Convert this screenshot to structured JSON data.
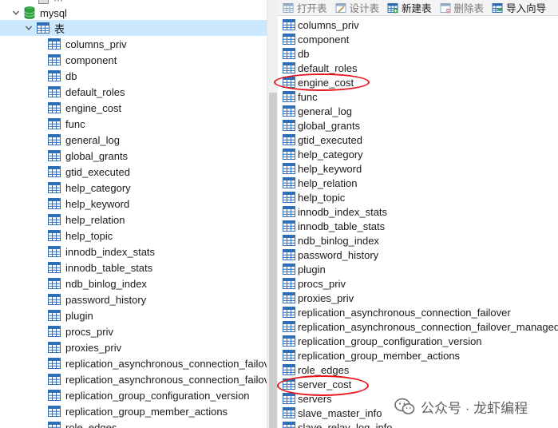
{
  "tree": {
    "top_stub_label": "···",
    "database": "mysql",
    "tables_folder": "表",
    "tables": [
      "columns_priv",
      "component",
      "db",
      "default_roles",
      "engine_cost",
      "func",
      "general_log",
      "global_grants",
      "gtid_executed",
      "help_category",
      "help_keyword",
      "help_relation",
      "help_topic",
      "innodb_index_stats",
      "innodb_table_stats",
      "ndb_binlog_index",
      "password_history",
      "plugin",
      "procs_priv",
      "proxies_priv",
      "replication_asynchronous_connection_failove",
      "replication_asynchronous_connection_failove",
      "replication_group_configuration_version",
      "replication_group_member_actions",
      "role_edges"
    ]
  },
  "toolbar": {
    "open_table": "打开表",
    "design_table": "设计表",
    "new_table": "新建表",
    "delete_table": "删除表",
    "import_wizard": "导入向导"
  },
  "objects": [
    "columns_priv",
    "component",
    "db",
    "default_roles",
    "engine_cost",
    "func",
    "general_log",
    "global_grants",
    "gtid_executed",
    "help_category",
    "help_keyword",
    "help_relation",
    "help_topic",
    "innodb_index_stats",
    "innodb_table_stats",
    "ndb_binlog_index",
    "password_history",
    "plugin",
    "procs_priv",
    "proxies_priv",
    "replication_asynchronous_connection_failover",
    "replication_asynchronous_connection_failover_managed",
    "replication_group_configuration_version",
    "replication_group_member_actions",
    "role_edges",
    "server_cost",
    "servers",
    "slave_master_info",
    "slave_relay_log_info"
  ],
  "annotations": [
    "engine_cost",
    "server_cost"
  ],
  "watermark": "公众号 · 龙虾编程",
  "colors": {
    "selection": "#cce8ff",
    "annotation": "#e8141c",
    "table_icon": "#2f6db5",
    "db_icon": "#2e9e3e"
  }
}
